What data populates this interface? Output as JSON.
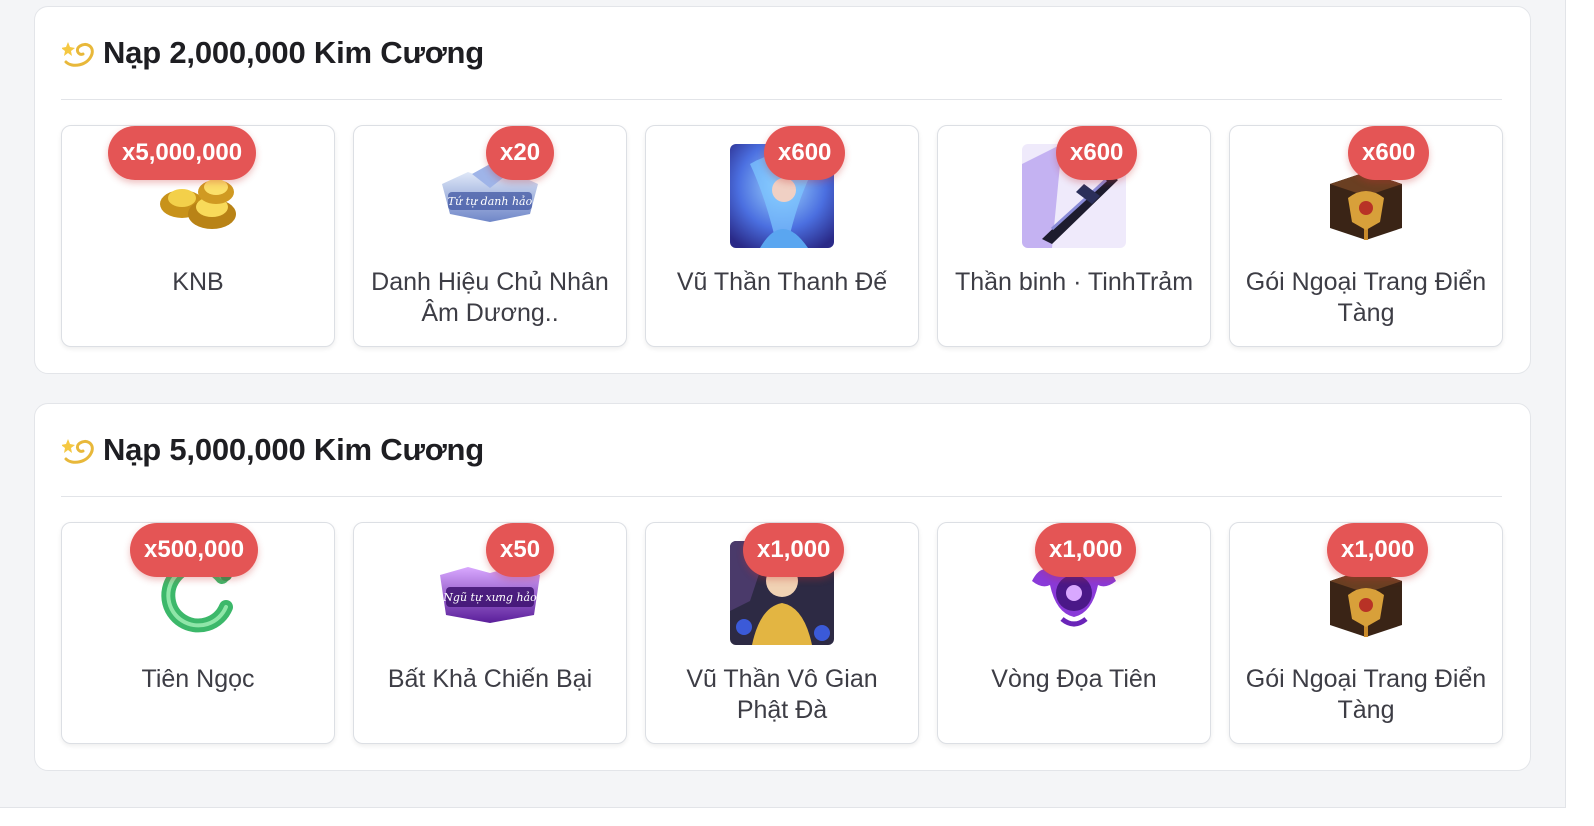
{
  "sections": [
    {
      "title": "Nạp 2,000,000 Kim Cương",
      "icon": "dizzy-star-icon",
      "items": [
        {
          "badge": "x5,000,000",
          "name": "KNB",
          "icon": "gold-ingot-icon"
        },
        {
          "badge": "x20",
          "name": "Danh Hiệu Chủ Nhân Âm Dương..",
          "icon": "title-banner-icon",
          "image_text": "Tứ tự danh hảo"
        },
        {
          "badge": "x600",
          "name": "Vũ Thần Thanh Đế",
          "icon": "character-portrait-icon"
        },
        {
          "badge": "x600",
          "name": "Thần binh · TinhTrảm",
          "icon": "weapon-sword-icon"
        },
        {
          "badge": "x600",
          "name": "Gói Ngoại Trang Điển Tàng",
          "icon": "treasure-chest-icon"
        }
      ]
    },
    {
      "title": "Nạp 5,000,000 Kim Cương",
      "icon": "dizzy-star-icon",
      "items": [
        {
          "badge": "x500,000",
          "name": "Tiên Ngọc",
          "icon": "jade-ring-icon"
        },
        {
          "badge": "x50",
          "name": "Bất Khả Chiến Bại",
          "icon": "title-banner-icon",
          "image_text": "Ngũ tự xưng hảo"
        },
        {
          "badge": "x1,000",
          "name": "Vũ Thần Vô Gian Phật Đà",
          "icon": "character-portrait-icon"
        },
        {
          "badge": "x1,000",
          "name": "Vòng Đọa Tiên",
          "icon": "purple-halo-icon"
        },
        {
          "badge": "x1,000",
          "name": "Gói Ngoại Trang Điển Tàng",
          "icon": "treasure-chest-icon"
        }
      ]
    }
  ],
  "colors": {
    "badge": "#e45555",
    "card_border": "#dcdfe4",
    "page_bg": "#f4f5f7"
  }
}
